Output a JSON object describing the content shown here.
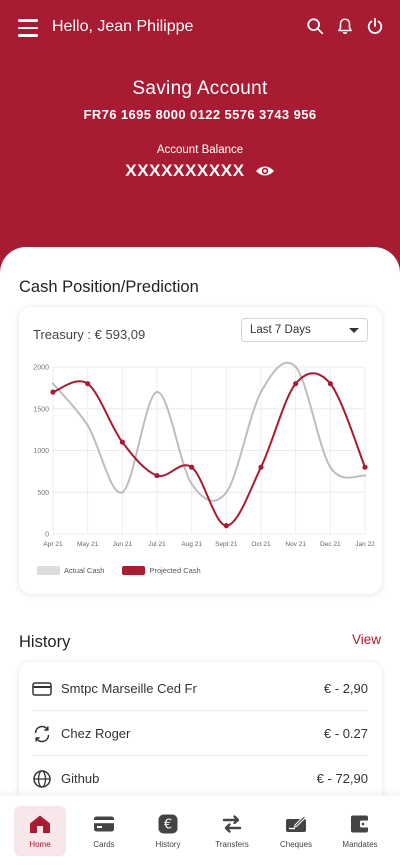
{
  "colors": {
    "brand": "#a71c32",
    "actual_series": "#bdbdbd",
    "projected_series": "#a71c32"
  },
  "header": {
    "greeting": "Hello, Jean Philippe",
    "menu_icon": "hamburger-icon",
    "icons": [
      "search-icon",
      "bell-icon",
      "power-icon"
    ],
    "account_title": "Saving Account",
    "iban": "FR76 1695 8000 0122 5576 3743 956",
    "balance_label": "Account Balance",
    "balance_value": "XXXXXXXXXX",
    "visibility_icon": "eye-icon"
  },
  "cash_section": {
    "title": "Cash Position/Prediction",
    "treasury": "Treasury : € 593,09",
    "period": "Last 7 Days"
  },
  "chart_data": {
    "type": "line",
    "x": [
      "Apr 21",
      "May 21",
      "Jun 21",
      "Jul 21",
      "Aug 21",
      "Sept 21",
      "Oct 21",
      "Nov 21",
      "Dec 21",
      "Jan 22"
    ],
    "y_ticks": [
      "0",
      "500",
      "1000",
      "1500",
      "2000"
    ],
    "ylim": [
      0,
      2000
    ],
    "grid": true,
    "legend_position": "bottom-left",
    "series": [
      {
        "name": "Actual Cash",
        "values": [
          1800,
          1300,
          500,
          1700,
          600,
          500,
          1700,
          2000,
          800,
          700
        ]
      },
      {
        "name": "Projected Cash",
        "values": [
          1700,
          1800,
          1100,
          700,
          800,
          100,
          800,
          1800,
          1800,
          800
        ]
      }
    ]
  },
  "history": {
    "title": "History",
    "view_label": "View",
    "items": [
      {
        "icon": "card-icon",
        "name": "Smtpc Marseille Ced Fr",
        "amount": "€ - 2,90"
      },
      {
        "icon": "sync-icon",
        "name": "Chez Roger",
        "amount": "€ - 0.27"
      },
      {
        "icon": "globe-icon",
        "name": "Github",
        "amount": "€ - 72,90"
      }
    ]
  },
  "nav": {
    "items": [
      {
        "label": "Home",
        "icon": "home-icon",
        "active": true
      },
      {
        "label": "Cards",
        "icon": "cards-icon"
      },
      {
        "label": "History",
        "icon": "euro-icon"
      },
      {
        "label": "Transfers",
        "icon": "transfer-icon"
      },
      {
        "label": "Cheques",
        "icon": "cheque-icon"
      },
      {
        "label": "Mandates",
        "icon": "wallet-icon"
      }
    ]
  }
}
